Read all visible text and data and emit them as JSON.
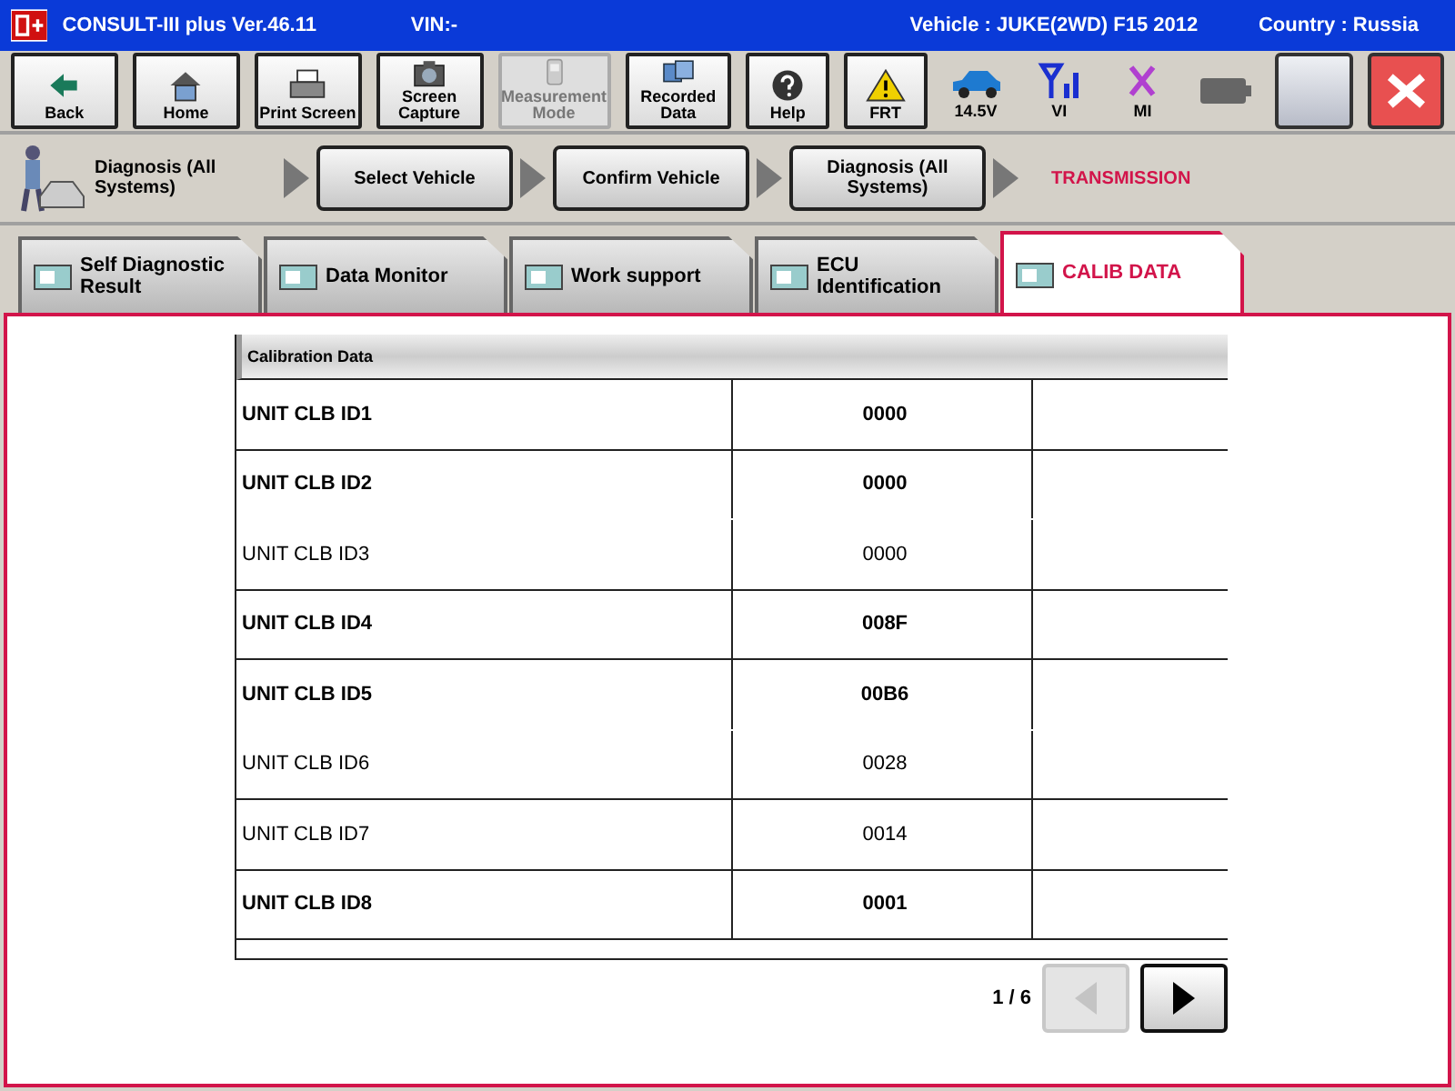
{
  "window": {
    "title": "CONSULT-III plus  Ver.46.11",
    "vin": "VIN:-",
    "vehicle": "Vehicle : JUKE(2WD) F15 2012",
    "country": "Country : Russia"
  },
  "toolbar": [
    {
      "kind": "back",
      "label": "Back",
      "disabled": false
    },
    {
      "kind": "home",
      "label": "Home",
      "disabled": false
    },
    {
      "kind": "print",
      "label": "Print Screen",
      "disabled": false
    },
    {
      "kind": "camera",
      "label": "Screen Capture",
      "disabled": false
    },
    {
      "kind": "measure",
      "label": "Measurement Mode",
      "disabled": true
    },
    {
      "kind": "recorded",
      "label": "Recorded Data",
      "disabled": false
    },
    {
      "kind": "help",
      "label": "Help",
      "disabled": false
    },
    {
      "kind": "frt",
      "label": "FRT",
      "disabled": false
    }
  ],
  "status": [
    {
      "kind": "car",
      "label": "14.5V"
    },
    {
      "kind": "signal",
      "label": "VI"
    },
    {
      "kind": "cross",
      "label": "MI"
    },
    {
      "kind": "battery"
    }
  ],
  "breadcrumb": {
    "start": "Diagnosis (All Systems)",
    "steps": [
      {
        "label": "Select Vehicle"
      },
      {
        "label": "Confirm Vehicle"
      },
      {
        "label": "Diagnosis (All Systems)"
      }
    ],
    "current": "TRANSMISSION"
  },
  "tabs": [
    {
      "label": "Self Diagnostic Result",
      "selected": false
    },
    {
      "label": "Data Monitor",
      "selected": false
    },
    {
      "label": "Work support",
      "selected": false
    },
    {
      "label": "ECU Identification",
      "selected": false
    },
    {
      "label": "CALIB DATA",
      "selected": true
    }
  ],
  "table": {
    "title": "Calibration Data",
    "rows": [
      {
        "name": "UNIT CLB ID1",
        "value": "0000",
        "bold": true,
        "divider": true
      },
      {
        "name": "UNIT CLB ID2",
        "value": "0000",
        "bold": true,
        "divider": false
      },
      {
        "name": "UNIT CLB ID3",
        "value": "0000",
        "bold": false,
        "divider": true
      },
      {
        "name": "UNIT CLB ID4",
        "value": "008F",
        "bold": true,
        "divider": true
      },
      {
        "name": "UNIT CLB ID5",
        "value": "00B6",
        "bold": true,
        "divider": false
      },
      {
        "name": "UNIT CLB ID6",
        "value": "0028",
        "bold": false,
        "divider": true
      },
      {
        "name": "UNIT CLB ID7",
        "value": "0014",
        "bold": false,
        "divider": true
      },
      {
        "name": "UNIT CLB ID8",
        "value": "0001",
        "bold": true,
        "divider": true
      }
    ]
  },
  "pager": {
    "text": "1 / 6",
    "prev_disabled": true,
    "next_disabled": false
  }
}
